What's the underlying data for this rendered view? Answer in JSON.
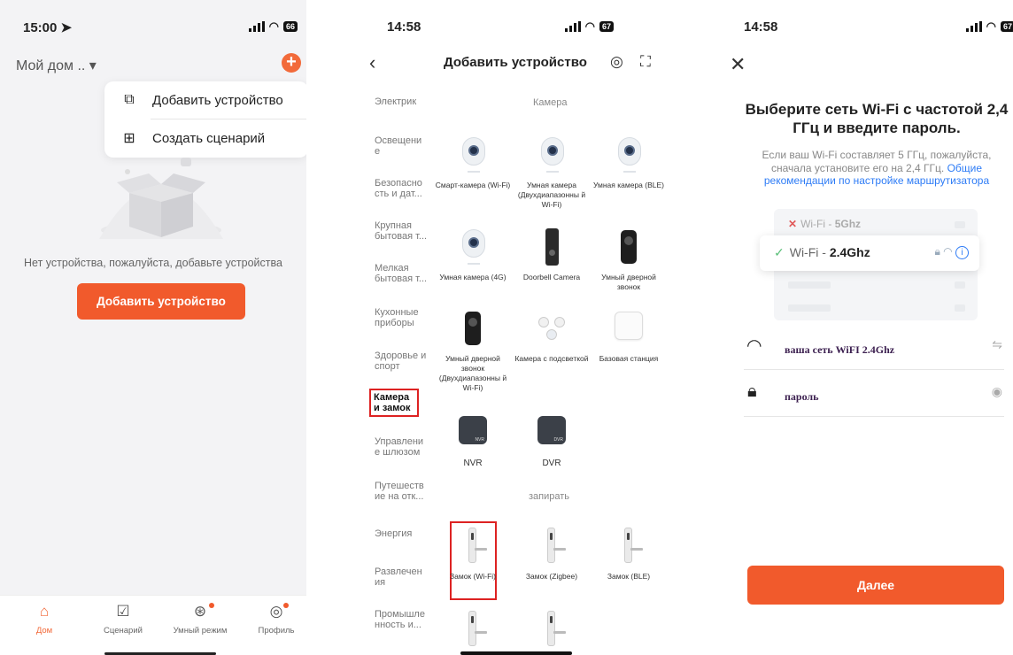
{
  "colors": {
    "accent": "#f15a2c",
    "link": "#2e7cf6",
    "highlight_box": "#dd2222"
  },
  "screen1": {
    "status": {
      "time": "15:00 ➤",
      "battery": "66"
    },
    "home_title": "Мой дом .. ▾",
    "menu": [
      {
        "label": "Добавить устройство",
        "icon": "add-device-icon"
      },
      {
        "label": "Создать сценарий",
        "icon": "create-scene-icon"
      }
    ],
    "empty_message": "Нет устройства, пожалуйста, добавьте устройства",
    "add_button": "Добавить устройство",
    "tabs": [
      {
        "label": "Дом",
        "icon": "home-icon",
        "active": true
      },
      {
        "label": "Сценарий",
        "icon": "scene-icon"
      },
      {
        "label": "Умный режим",
        "icon": "smart-mode-icon"
      },
      {
        "label": "Профиль",
        "icon": "profile-icon"
      }
    ]
  },
  "screen2": {
    "status": {
      "time": "14:58",
      "battery": "67"
    },
    "title": "Добавить устройство",
    "categories": [
      "Электрик",
      "Освещени е",
      "Безопасно сть и дат...",
      "Крупная бытовая т...",
      "Мелкая бытовая т...",
      "Кухонные приборы",
      "Здоровье и спорт",
      "Камера и замок",
      "Управлени е шлюзом",
      "Путешеств ие на отк...",
      "Энергия",
      "Развлечен ия",
      "Промышле нность и..."
    ],
    "selected_category": "Камера и замок",
    "section_camera": "Камера",
    "section_lock": "запирать",
    "devices": [
      "Смарт-камера (Wi-Fi)",
      "Умная камера (Двухдиапазонны й Wi-Fi)",
      "Умная камера (BLE)",
      "Умная камера (4G)",
      "Doorbell Camera",
      "Умный дверной звонок",
      "Умный дверной звонок (Двухдиапазонны й Wi-Fi)",
      "Камера с подсветкой",
      "Базовая станция",
      "NVR",
      "DVR",
      "Замок (Wi-Fi)",
      "Замок (Zigbee)",
      "Замок (BLE)"
    ],
    "nvr_tag": "NVR",
    "dvr_tag": "DVR"
  },
  "screen3": {
    "status": {
      "time": "14:58",
      "battery": "67"
    },
    "heading": "Выберите сеть Wi-Fi с частотой 2,4 ГГц и введите пароль.",
    "desc": "Если ваш Wi-Fi составляет 5 ГГц, пожалуйста, сначала установите его на 2,4 ГГц.",
    "desc_link": "Общие рекомендации по настройке маршрутизатора",
    "wifi_bad_prefix": "Wi-Fi - ",
    "wifi_bad_band": "5Ghz",
    "wifi_good_prefix": "Wi-Fi - ",
    "wifi_good_band": "2.4Ghz",
    "ssid_value": "ваша сеть WiFI 2.4Ghz",
    "password_value": "пароль",
    "next_button": "Далее"
  }
}
